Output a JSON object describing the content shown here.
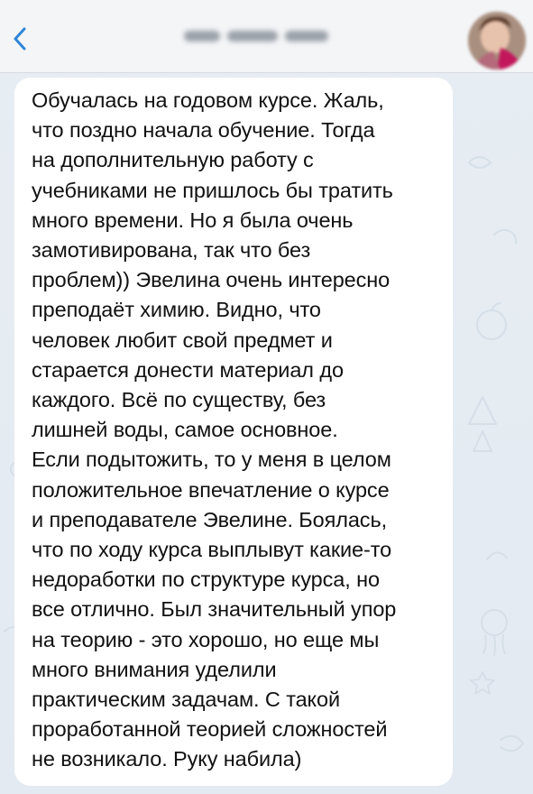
{
  "colors": {
    "accent": "#2f86d6",
    "chat_background": "#e7edf3",
    "header_background": "#f4f5f7",
    "bubble_background": "#ffffff",
    "message_text": "#111111"
  },
  "header": {
    "back_icon": "chevron-left-icon",
    "avatar": "contact-avatar"
  },
  "message": {
    "lines": [
      "Обучалась на годовом курсе. Жаль,",
      "что поздно начала обучение. Тогда",
      "на дополнительную работу с",
      "учебниками не пришлось бы тратить",
      "много времени. Но я была очень",
      "замотивирована, так что без",
      "проблем)) Эвелина очень интересно",
      "преподаёт химию. Видно, что",
      "человек любит свой предмет и",
      "старается донести материал до",
      "каждого. Всё по существу, без",
      "лишней воды, самое основное.",
      "Если подытожить, то у меня в целом",
      "положительное впечатление о курсе",
      "и преподавателе Эвелине. Боялась,",
      "что по ходу курса выплывут какие-то",
      "недоработки по структуре курса, но",
      "все отлично. Был значительный упор",
      "на теорию - это хорошо, но еще мы",
      "много внимания уделили",
      "практическим задачам. С такой",
      "проработанной теорией сложностей",
      "не возникало. Руку набила)"
    ]
  }
}
